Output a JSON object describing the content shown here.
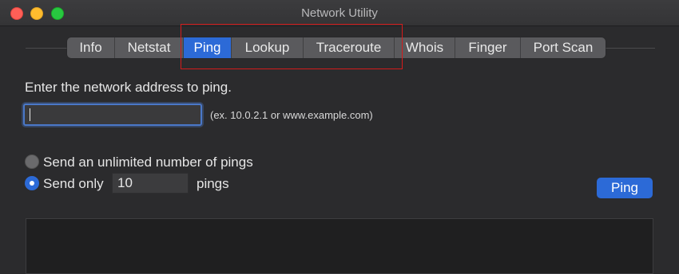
{
  "window": {
    "title": "Network Utility"
  },
  "tabs": [
    {
      "label": "Info",
      "active": false
    },
    {
      "label": "Netstat",
      "active": false
    },
    {
      "label": "Ping",
      "active": true
    },
    {
      "label": "Lookup",
      "active": false
    },
    {
      "label": "Traceroute",
      "active": false
    },
    {
      "label": "Whois",
      "active": false
    },
    {
      "label": "Finger",
      "active": false
    },
    {
      "label": "Port Scan",
      "active": false
    }
  ],
  "ping": {
    "prompt": "Enter the network address to ping.",
    "address_value": "",
    "address_hint": "(ex. 10.0.2.1 or www.example.com)",
    "option_unlimited": "Send an unlimited number of pings",
    "option_only": "Send only",
    "selected_option": "only",
    "count_value": "10",
    "count_suffix": "pings",
    "button_label": "Ping"
  },
  "colors": {
    "accent": "#2c6ad7",
    "highlight": "#d51b1b"
  }
}
